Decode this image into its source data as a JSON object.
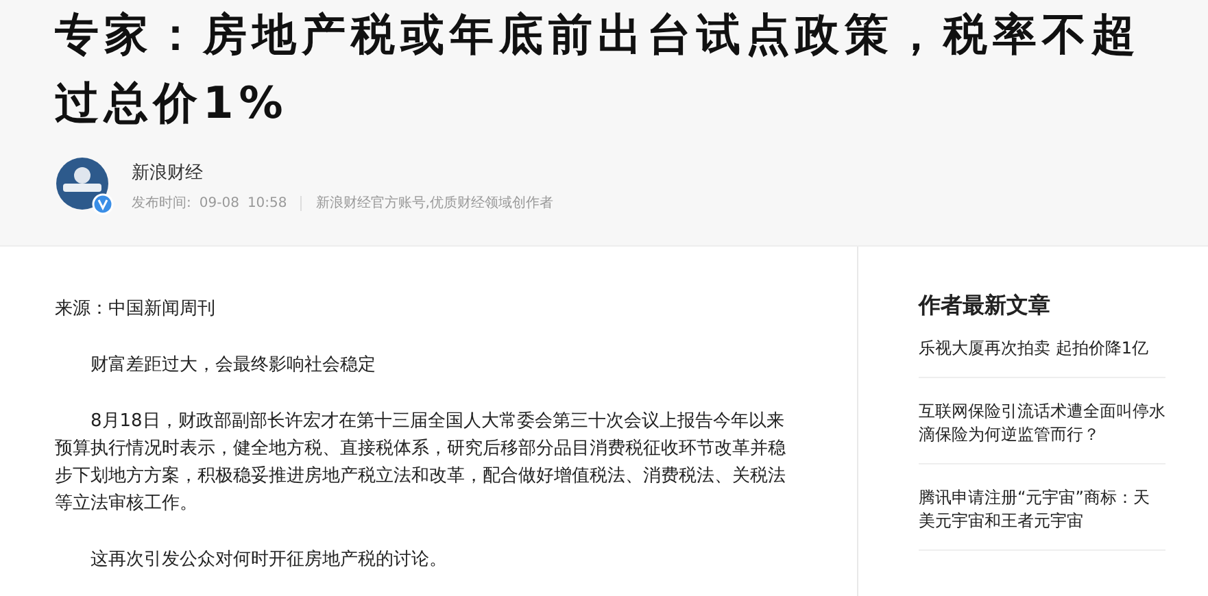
{
  "headline": "专家：房地产税或年底前出台试点政策，税率不超过总价1%",
  "author": {
    "name": "新浪财经",
    "published_label": "发布时间:",
    "date": "09-08",
    "time": "10:58",
    "description": "新浪财经官方账号,优质财经领域创作者"
  },
  "article": {
    "source": "来源：中国新闻周刊",
    "paragraphs": [
      "财富差距过大，会最终影响社会稳定",
      "8月18日，财政部副部长许宏才在第十三届全国人大常委会第三十次会议上报告今年以来预算执行情况时表示，健全地方税、直接税体系，研究后移部分品目消费税征收环节改革并稳步下划地方方案，积极稳妥推进房地产税立法和改革，配合做好增值税法、消费税法、关税法等立法审核工作。",
      "这再次引发公众对何时开征房地产税的讨论。"
    ]
  },
  "sidebar": {
    "title": "作者最新文章",
    "articles": [
      "乐视大厦再次拍卖 起拍价降1亿",
      "互联网保险引流话术遭全面叫停水滴保险为何逆监管而行？",
      "腾讯申请注册“元宇宙”商标：天美元宇宙和王者元宇宙"
    ]
  }
}
